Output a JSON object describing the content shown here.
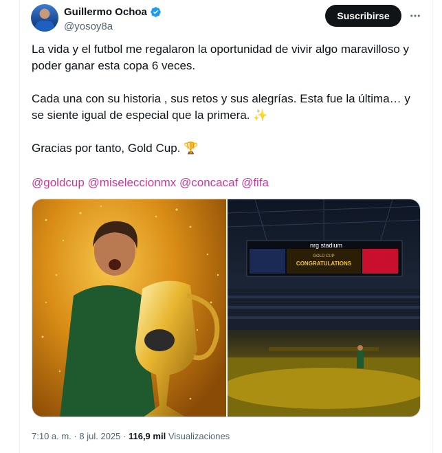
{
  "author": {
    "name": "Guillermo Ochoa",
    "handle": "@yosoy8a",
    "verified": true
  },
  "actions": {
    "subscribe_label": "Suscribirse",
    "more_icon": "more-horizontal-icon"
  },
  "tweet": {
    "paragraph_1": "La vida y el futbol me regalaron la oportunidad de vivir algo maravilloso y poder ganar esta copa 6 veces.",
    "paragraph_2": "Cada una con su historia , sus retos y sus alegrías. Esta fue la última… y se siente igual de especial que la primera. ✨",
    "paragraph_3": "Gracias por tanto, Gold Cup. 🏆",
    "mentions": [
      "@goldcup",
      "@miseleccionmx",
      "@concacaf",
      "@fifa"
    ]
  },
  "media": {
    "image_1": "Portero celebrando con el trofeo de la Gold Cup bajo confeti dorado",
    "image_2": "Estadio NRG con pantalla de felicitaciones de la Gold Cup",
    "scoreboard": {
      "brand": "nrg stadium",
      "banner": "CONGRATULATIONS",
      "event": "GOLD CUP"
    }
  },
  "meta": {
    "time": "7:10 a. m.",
    "date": "8 jul. 2025",
    "views_count": "116,9 mil",
    "views_label": "Visualizaciones"
  },
  "colors": {
    "mention": "#c9399c",
    "verified": "#1d9bf0",
    "button_bg": "#0f1419",
    "secondary_text": "#536471"
  }
}
